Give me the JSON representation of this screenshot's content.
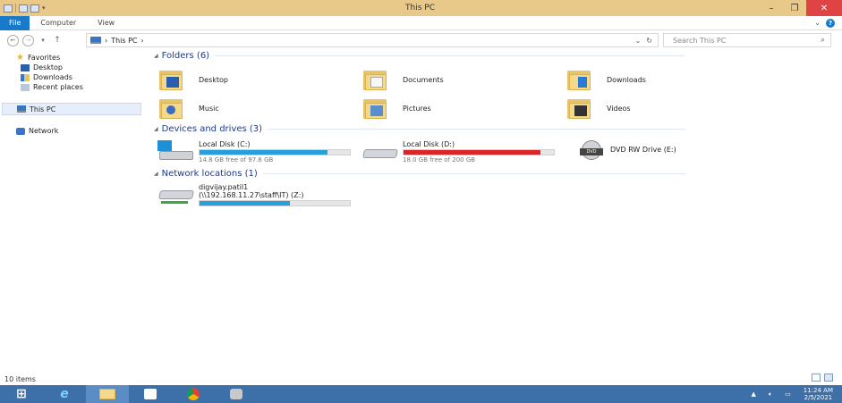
{
  "window": {
    "title": "This PC"
  },
  "ribbon": {
    "tabs": [
      "File",
      "Computer",
      "View"
    ]
  },
  "address": {
    "path_root": "This PC",
    "separator": "›",
    "search_placeholder": "Search This PC"
  },
  "sidebar": {
    "favorites": {
      "label": "Favorites",
      "items": [
        "Desktop",
        "Downloads",
        "Recent places"
      ]
    },
    "this_pc": "This PC",
    "network": "Network"
  },
  "sections": {
    "folders": {
      "title": "Folders (6)",
      "items": [
        "Desktop",
        "Documents",
        "Downloads",
        "Music",
        "Pictures",
        "Videos"
      ]
    },
    "devices": {
      "title": "Devices and drives (3)"
    },
    "network": {
      "title": "Network locations (1)"
    }
  },
  "drives": [
    {
      "name": "Local Disk (C:)",
      "free_text": "14.8 GB free of 97.6 GB",
      "used_fraction": 0.85,
      "bar_color": "#26a0da"
    },
    {
      "name": "Local Disk (D:)",
      "free_text": "18.0 GB free of 200 GB",
      "used_fraction": 0.91,
      "bar_color": "#da2626"
    },
    {
      "name": "DVD RW Drive (E:)",
      "icon_label": "DVD"
    }
  ],
  "network_location": {
    "name_line1": "digvijay.patil1",
    "name_line2": "(\\\\192.168.11.27\\staff\\IT) (Z:)",
    "used_fraction": 0.6,
    "bar_color": "#26a0da"
  },
  "status": {
    "items": "10 items"
  },
  "taskbar": {
    "time": "11:24 AM",
    "date": "2/5/2021"
  }
}
